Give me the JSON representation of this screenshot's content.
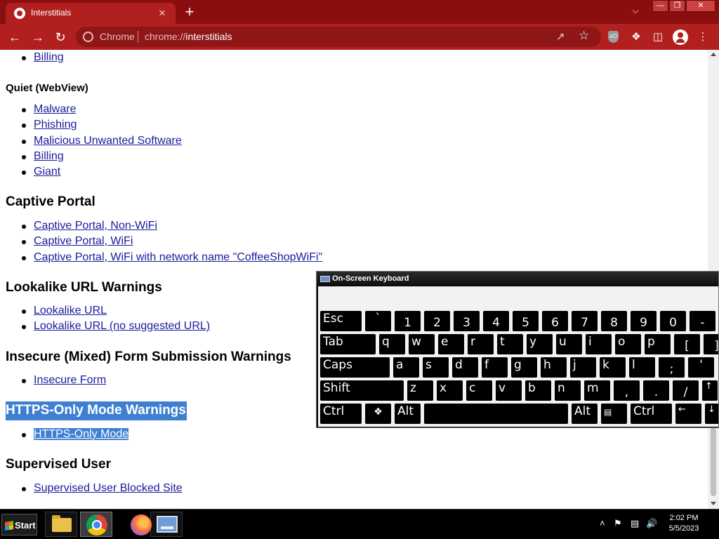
{
  "browser": {
    "tab_title": "Interstitials",
    "tab_close": "✕",
    "new_tab": "+",
    "omnibox_chip": "Chrome",
    "url_scheme": "chrome://",
    "url_host": "interstitials",
    "theme_color": "#b21f1f"
  },
  "page": {
    "top_link": "Billing",
    "sections": [
      {
        "heading": "Quiet (WebView)",
        "links": [
          "Malware",
          "Phishing",
          "Malicious Unwanted Software",
          "Billing",
          "Giant"
        ]
      },
      {
        "heading": "Captive Portal",
        "links": [
          "Captive Portal, Non-WiFi",
          "Captive Portal, WiFi",
          "Captive Portal, WiFi with network name \"CoffeeShopWiFi\""
        ]
      },
      {
        "heading": "Lookalike URL Warnings",
        "links": [
          "Lookalike URL",
          "Lookalike URL (no suggested URL)"
        ]
      },
      {
        "heading": "Insecure (Mixed) Form Submission Warnings",
        "links": [
          "Insecure Form"
        ]
      },
      {
        "heading": "HTTPS-Only Mode Warnings",
        "links": [
          "HTTPS-Only Mode"
        ]
      },
      {
        "heading": "Supervised User",
        "links": [
          "Supervised User Blocked Site"
        ]
      }
    ],
    "selection_color": "#3f7fd0",
    "link_color": "#1a1a9c"
  },
  "keyboard": {
    "title": "On-Screen Keyboard",
    "rows": [
      [
        "Esc",
        "`",
        "1",
        "2",
        "3",
        "4",
        "5",
        "6",
        "7",
        "8",
        "9",
        "0",
        "-"
      ],
      [
        "Tab",
        "q",
        "w",
        "e",
        "r",
        "t",
        "y",
        "u",
        "i",
        "o",
        "p",
        "[",
        "]"
      ],
      [
        "Caps",
        "a",
        "s",
        "d",
        "f",
        "g",
        "h",
        "j",
        "k",
        "l",
        ";",
        "'"
      ],
      [
        "Shift",
        "z",
        "x",
        "c",
        "v",
        "b",
        "n",
        "m",
        ",",
        ".",
        "/",
        "↑"
      ],
      [
        "Ctrl",
        "win-logo-icon",
        "Alt",
        "",
        "Alt",
        "menu-icon",
        "Ctrl",
        "←",
        "↓"
      ]
    ]
  },
  "taskbar": {
    "start_label": "Start",
    "clock_time": "2:02 PM",
    "clock_date": "5/5/2023"
  }
}
